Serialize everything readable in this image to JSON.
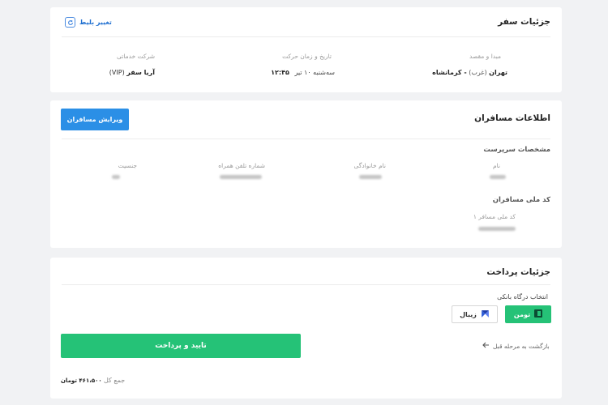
{
  "trip": {
    "title": "جزئیات سفر",
    "change_ticket": "تغییر بلیط",
    "route_label": "مبدا و مقصد",
    "origin": "تهران",
    "origin_note": "(غرب)",
    "destination": "- کرمانشاه",
    "datetime_label": "تاریخ و زمان حرکت",
    "date": "سه‌شنبه ۱۰ تیر",
    "time": "۱۲:۴۵",
    "company_label": "شرکت خدماتی",
    "company": "آریا سفر",
    "company_note": "(VIP)"
  },
  "passengers": {
    "title": "اطلاعات مسافران",
    "edit_button": "ویرایش مسافران",
    "supervisor_heading": "مشخصات سرپرست",
    "name_label": "نام",
    "family_label": "نام خانوادگی",
    "phone_label": "شماره تلفن همراه",
    "gender_label": "جنسیت",
    "national_heading": "کد ملی مسافران",
    "national_label": "کد ملی مسافر ۱"
  },
  "payment": {
    "title": "جزئیات پرداخت",
    "gateway_label": "انتخاب درگاه بانکی",
    "gateways": [
      "تومن",
      "زیبال"
    ],
    "confirm_button": "تایید و پرداخت",
    "back_link": "بازگشت به مرحله قبل",
    "total_label": "جمع کل",
    "total_value": "۴۶۱،۵۰۰ تومان"
  }
}
